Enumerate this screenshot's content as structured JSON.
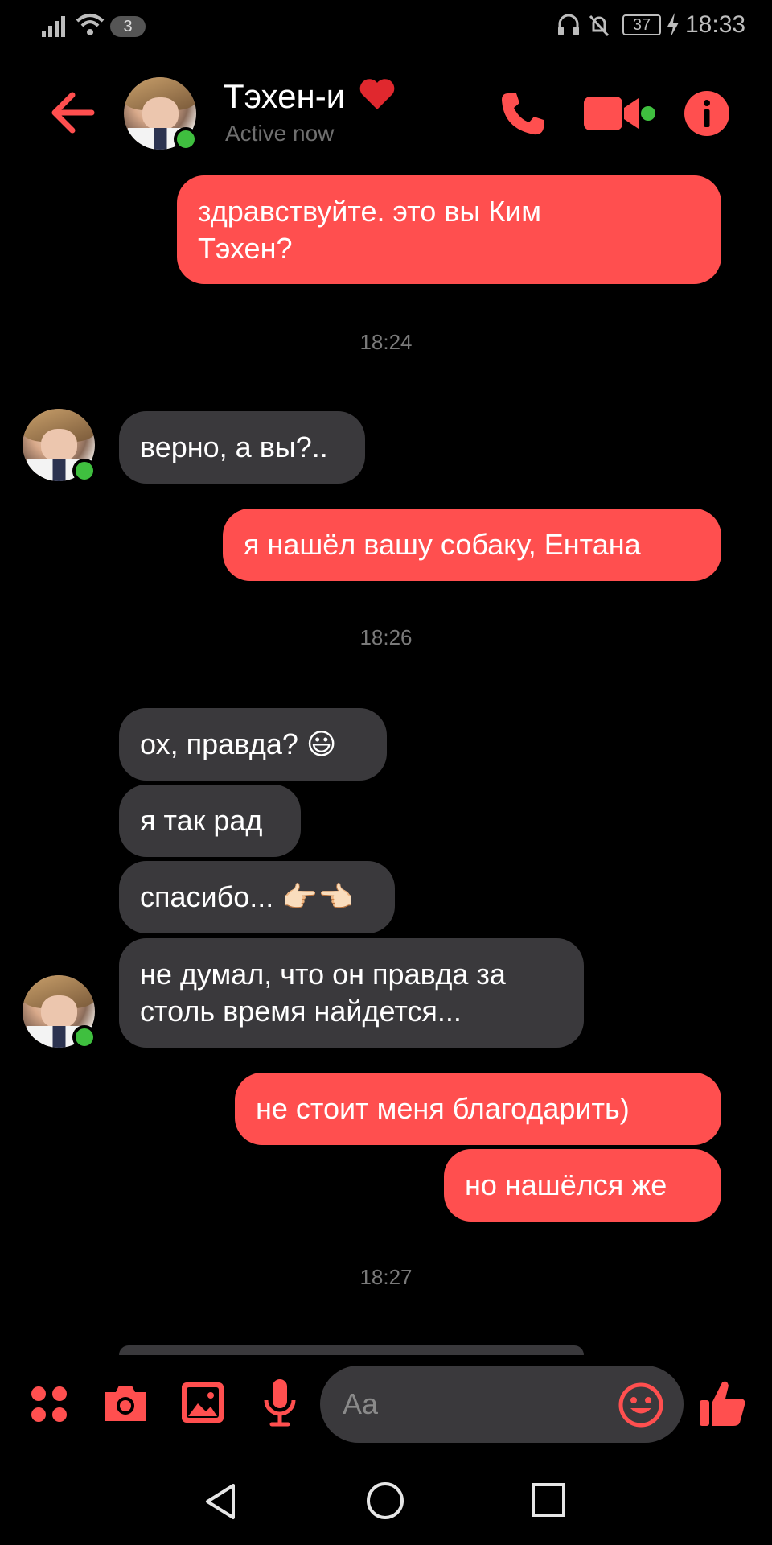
{
  "status_bar": {
    "sim_badge": "3",
    "battery": "37",
    "time": "18:33"
  },
  "header": {
    "contact_name": "Тэхен-и",
    "contact_status": "Active now"
  },
  "messages": [
    {
      "dir": "out",
      "text": "здравствуйте. это вы Ким\nТэхен?"
    },
    {
      "time": "18:24"
    },
    {
      "dir": "in",
      "text": "верно, а вы?.."
    },
    {
      "dir": "out",
      "text": "я нашёл вашу собаку, Ентана"
    },
    {
      "time": "18:26"
    },
    {
      "dir": "in",
      "text": "ох, правда? 😃"
    },
    {
      "dir": "in",
      "text": "я так рад"
    },
    {
      "dir": "in",
      "text": "спасибо... 👉🏻👈🏻"
    },
    {
      "dir": "in",
      "text": "не думал, что он правда за\nстоль время найдется..."
    },
    {
      "dir": "out",
      "text": "не стоит меня благодарить)"
    },
    {
      "dir": "out",
      "text": "но нашёлся же"
    },
    {
      "time": "18:27"
    }
  ],
  "composer": {
    "placeholder": "Aa"
  },
  "colors": {
    "accent": "#ff4f4f",
    "incoming_bubble": "#3a393c",
    "online": "#3fbf3f",
    "background": "#000000"
  },
  "icons": [
    "back-arrow-icon",
    "phone-icon",
    "video-camera-icon",
    "info-icon",
    "apps-icon",
    "camera-icon",
    "gallery-icon",
    "microphone-icon",
    "emoji-icon",
    "thumbs-up-icon",
    "nav-back-icon",
    "nav-home-icon",
    "nav-recents-icon"
  ]
}
